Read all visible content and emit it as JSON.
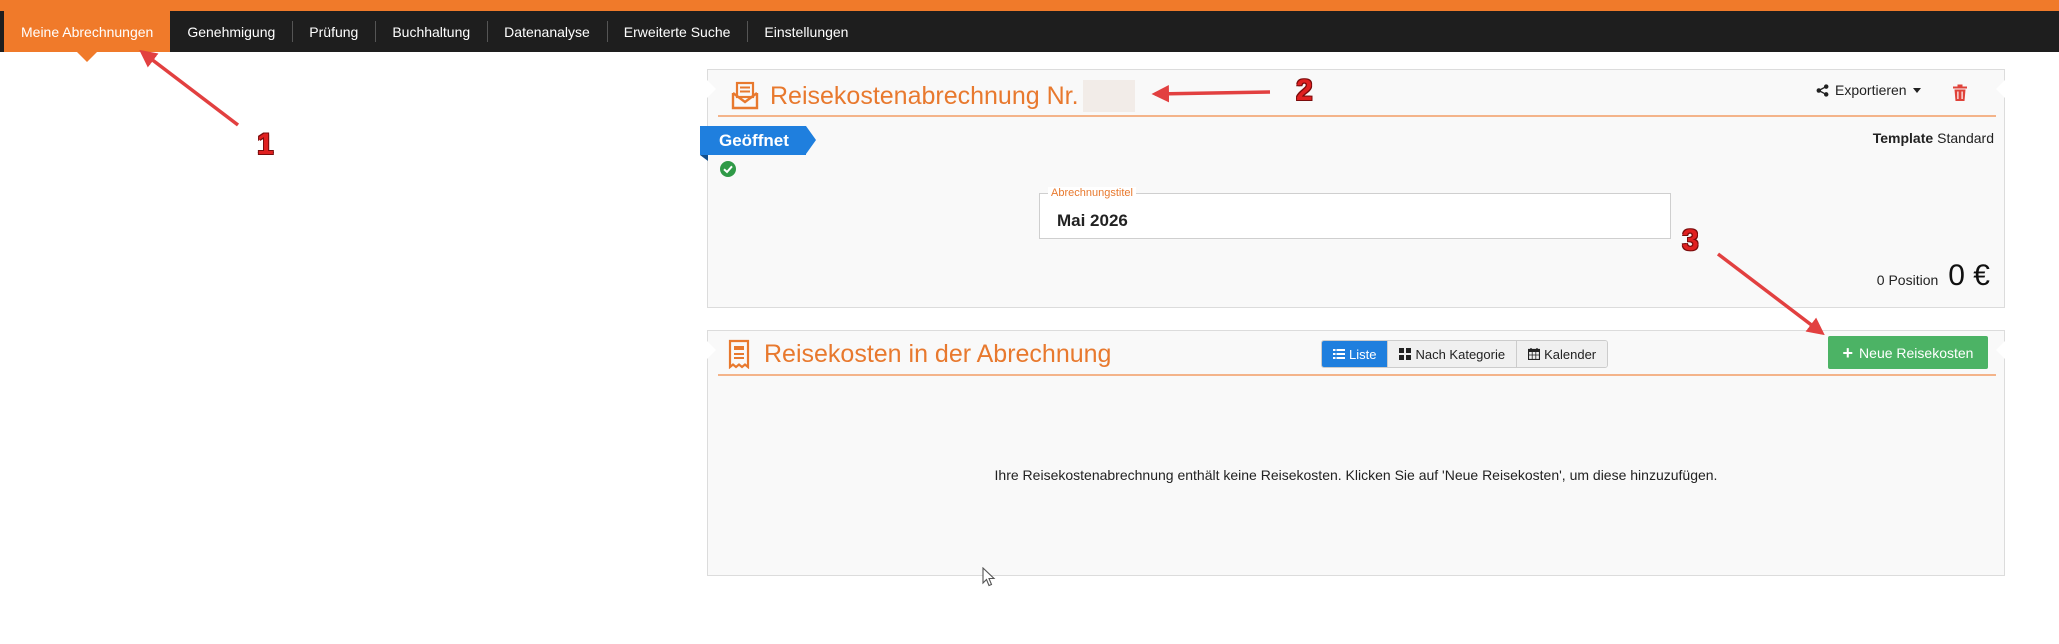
{
  "nav": {
    "items": [
      {
        "label": "Meine Abrechnungen",
        "active": true
      },
      {
        "label": "Genehmigung"
      },
      {
        "label": "Prüfung"
      },
      {
        "label": "Buchhaltung"
      },
      {
        "label": "Datenanalyse"
      },
      {
        "label": "Erweiterte Suche"
      },
      {
        "label": "Einstellungen"
      }
    ]
  },
  "report": {
    "title": "Reisekostenabrechnung Nr.",
    "export_label": "Exportieren",
    "status": "Geöffnet",
    "template_label": "Template",
    "template_value": "Standard",
    "field_label": "Abrechnungstitel",
    "field_value": "Mai 2026",
    "position_count": "0 Position",
    "total": "0 €"
  },
  "expenses": {
    "title": "Reisekosten in der Abrechnung",
    "views": [
      {
        "label": "Liste",
        "icon": "list-icon",
        "active": true
      },
      {
        "label": "Nach Kategorie",
        "icon": "grid-icon"
      },
      {
        "label": "Kalender",
        "icon": "calendar-icon"
      }
    ],
    "new_button": "Neue Reisekosten",
    "empty_message": "Ihre Reisekostenabrechnung enthält keine Reisekosten. Klicken Sie auf 'Neue Reisekosten', um diese hinzuzufügen."
  },
  "annotations": [
    "1",
    "2",
    "3"
  ],
  "colors": {
    "accent": "#f07a2a",
    "nav_bg": "#1e1e1e",
    "status_blue": "#1f7fde",
    "success_green": "#4cb365",
    "annotation_red": "#e02020"
  }
}
